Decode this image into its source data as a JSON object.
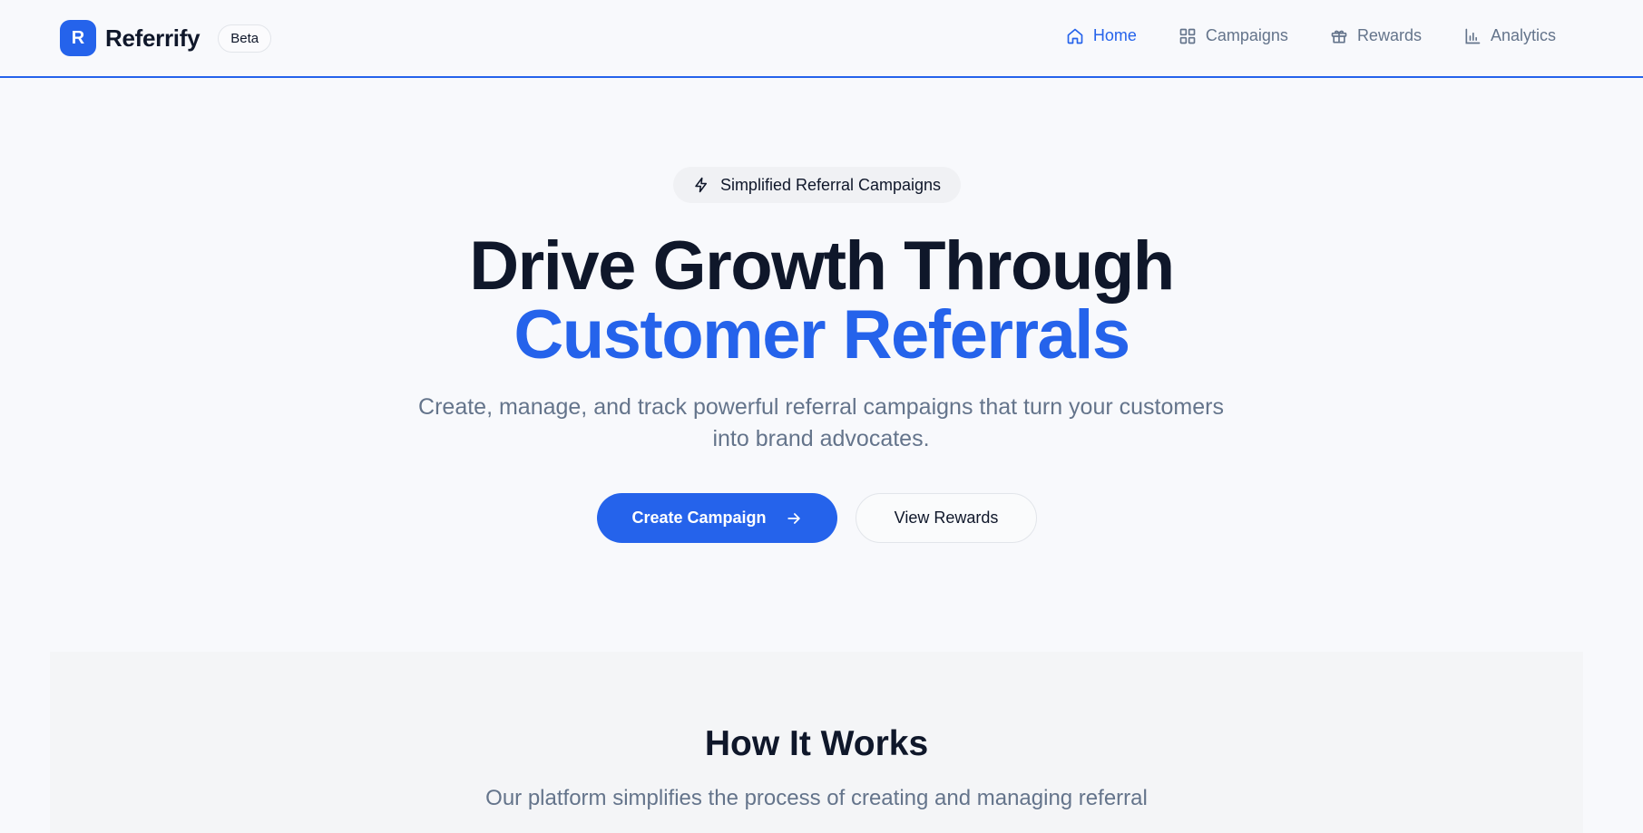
{
  "header": {
    "logo_letter": "R",
    "brand_name": "Referrify",
    "badge": "Beta",
    "nav": [
      {
        "label": "Home",
        "icon": "home-icon",
        "active": true
      },
      {
        "label": "Campaigns",
        "icon": "grid-icon",
        "active": false
      },
      {
        "label": "Rewards",
        "icon": "gift-icon",
        "active": false
      },
      {
        "label": "Analytics",
        "icon": "bar-chart-icon",
        "active": false
      }
    ]
  },
  "hero": {
    "pill_label": "Simplified Referral Campaigns",
    "pill_icon": "lightning-icon",
    "headline_line1": "Drive Growth Through",
    "headline_line2": "Customer Referrals",
    "subtitle": "Create, manage, and track powerful referral campaigns that turn your customers into brand advocates.",
    "primary_cta": "Create Campaign",
    "secondary_cta": "View Rewards"
  },
  "how_it_works": {
    "title": "How It Works",
    "subtitle": "Our platform simplifies the process of creating and managing referral"
  },
  "colors": {
    "accent": "#2563eb",
    "text_dark": "#0f172a",
    "text_muted": "#64748b",
    "background": "#f8f9fc"
  }
}
